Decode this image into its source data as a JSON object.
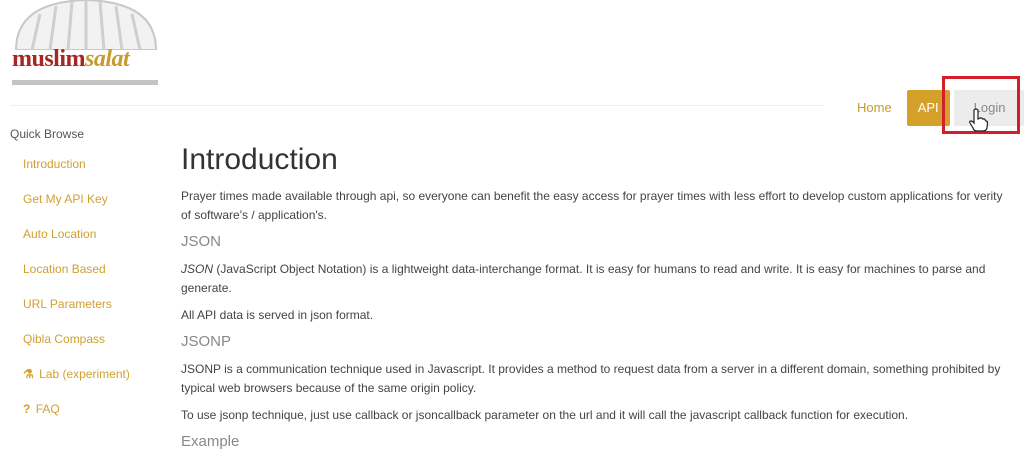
{
  "logo": {
    "part1": "muslim",
    "part2": "salat"
  },
  "nav": {
    "home": "Home",
    "api": "API",
    "login": "Login"
  },
  "sidebar": {
    "title": "Quick Browse",
    "items": [
      {
        "label": "Introduction",
        "icon": ""
      },
      {
        "label": "Get My API Key",
        "icon": ""
      },
      {
        "label": "Auto Location",
        "icon": ""
      },
      {
        "label": "Location Based",
        "icon": ""
      },
      {
        "label": "URL Parameters",
        "icon": ""
      },
      {
        "label": "Qibla Compass",
        "icon": ""
      },
      {
        "label": "Lab (experiment)",
        "icon": "flask-icon"
      },
      {
        "label": "FAQ",
        "icon": "question-icon"
      }
    ]
  },
  "main": {
    "title": "Introduction",
    "intro": "Prayer times made available through api, so everyone can benefit the easy access for prayer times with less effort to develop custom applications for verity of software's / application's.",
    "json": {
      "heading": "JSON",
      "p1_em": "JSON",
      "p1_rest": " (JavaScript Object Notation) is a lightweight data-interchange format. It is easy for humans to read and write. It is easy for machines to parse and generate.",
      "p2": "All API data is served in json format."
    },
    "jsonp": {
      "heading": "JSONP",
      "p1": "JSONP is a communication technique used in Javascript. It provides a method to request data from a server in a different domain, something prohibited by typical web browsers because of the same origin policy.",
      "p2": "To use jsonp technique, just use callback or jsoncallback parameter on the url and it will call the javascript callback function for execution."
    },
    "example_heading": "Example"
  },
  "colors": {
    "accent": "#d4a02a",
    "brand_red": "#a8261f",
    "highlight": "#d21f2b"
  }
}
